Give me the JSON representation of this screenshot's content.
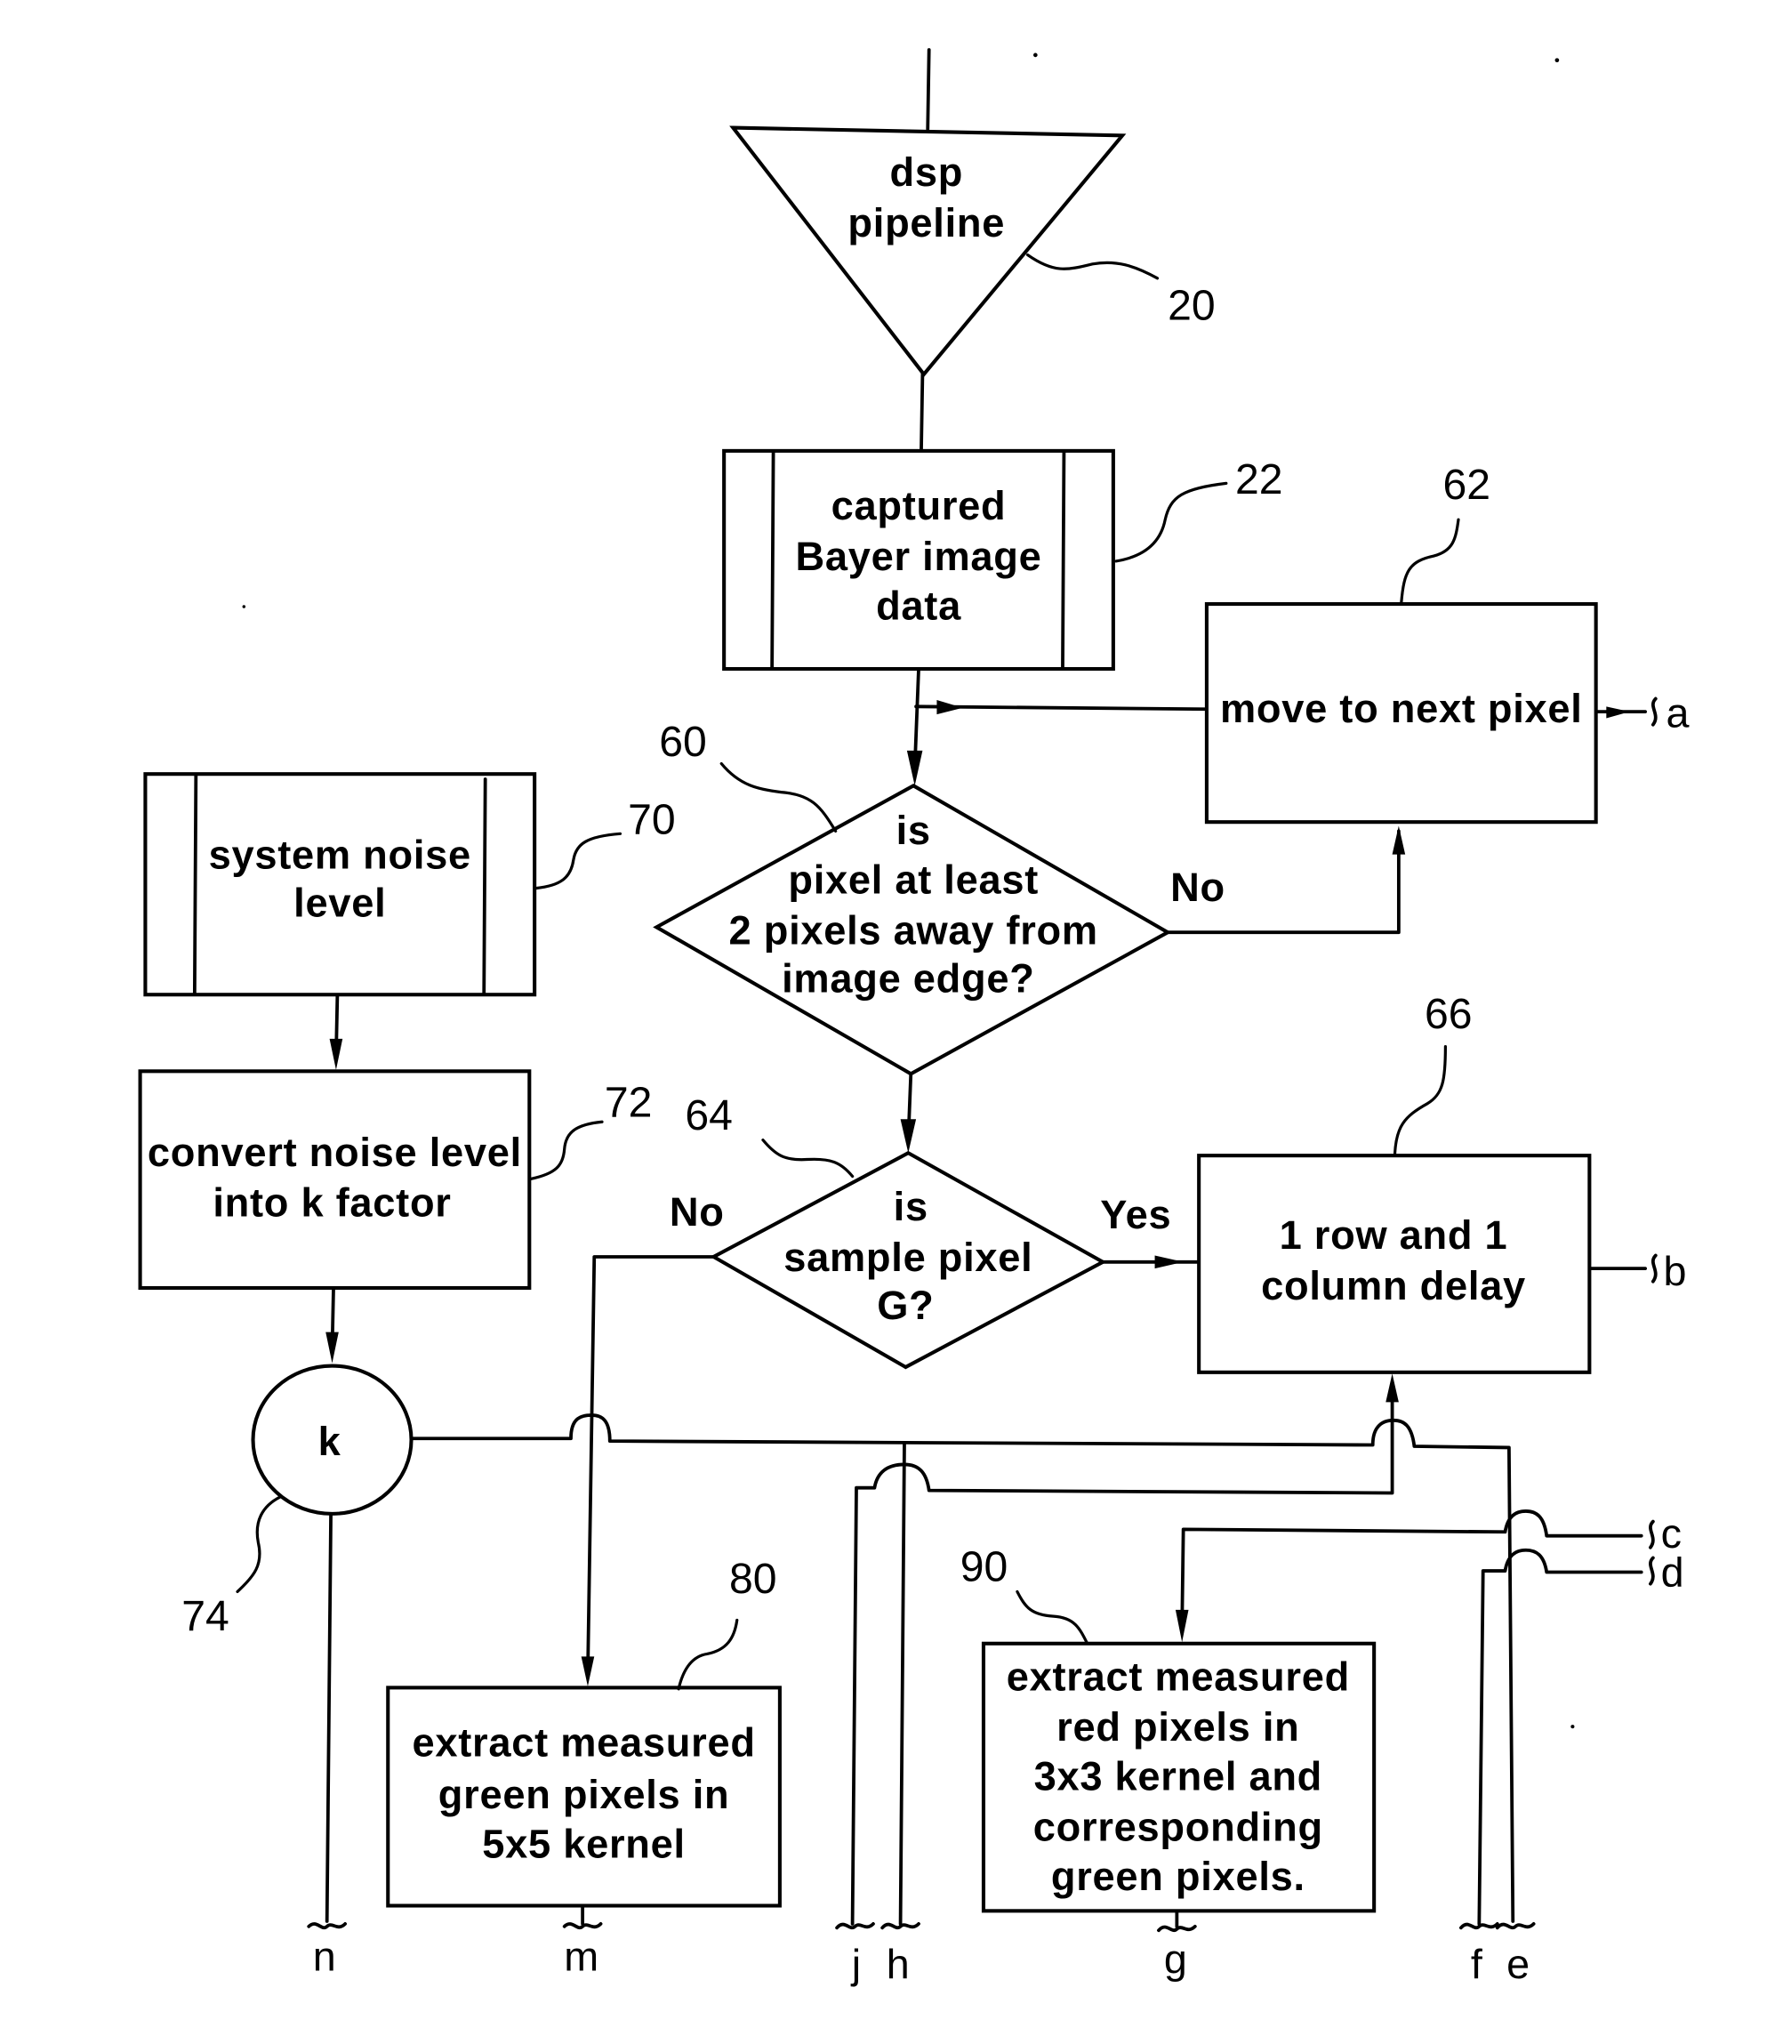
{
  "figure": {
    "type": "flowchart",
    "nodes": {
      "dsp_pipeline": {
        "ref": "20",
        "shape": "triangle",
        "lines": [
          "dsp",
          "pipeline"
        ]
      },
      "bayer_data": {
        "ref": "22",
        "shape": "predefined-process",
        "lines": [
          "captured",
          "Bayer image",
          "data"
        ]
      },
      "edge_check": {
        "ref": "60",
        "shape": "decision",
        "lines": [
          "is",
          "pixel at least",
          "2 pixels away from",
          "image edge?"
        ]
      },
      "next_pixel": {
        "ref": "62",
        "shape": "process",
        "lines": [
          "move to next pixel"
        ]
      },
      "green_check": {
        "ref": "64",
        "shape": "decision",
        "lines": [
          "is",
          "sample pixel",
          "G?"
        ]
      },
      "delay": {
        "ref": "66",
        "shape": "process",
        "lines": [
          "1 row and 1",
          "column delay"
        ]
      },
      "noise_level": {
        "ref": "70",
        "shape": "predefined-process",
        "lines": [
          "system noise",
          "level"
        ]
      },
      "k_factor": {
        "ref": "72",
        "shape": "process",
        "lines": [
          "convert noise level",
          "into k factor"
        ]
      },
      "k": {
        "ref": "74",
        "shape": "circle",
        "lines": [
          "k"
        ]
      },
      "green_extract": {
        "ref": "80",
        "shape": "process",
        "lines": [
          "extract measured",
          "green pixels in",
          "5x5 kernel"
        ]
      },
      "red_extract": {
        "ref": "90",
        "shape": "process",
        "lines": [
          "extract measured",
          "red pixels in",
          "3x3 kernel and",
          "corresponding",
          "green pixels."
        ]
      }
    },
    "edge_labels": {
      "edge_no": "No",
      "green_no": "No",
      "green_yes": "Yes"
    },
    "connectors": {
      "a": "a",
      "b": "b",
      "c": "c",
      "d": "d",
      "e": "e",
      "f": "f",
      "g": "g",
      "h": "h",
      "j": "j",
      "m": "m",
      "n": "n"
    },
    "edges": [
      [
        "input",
        "dsp_pipeline"
      ],
      [
        "dsp_pipeline",
        "bayer_data"
      ],
      [
        "bayer_data",
        "edge_check"
      ],
      [
        "next_pixel",
        "edge_check"
      ],
      [
        "edge_check",
        "next_pixel",
        "No"
      ],
      [
        "edge_check",
        "green_check"
      ],
      [
        "green_check",
        "delay",
        "Yes"
      ],
      [
        "green_check",
        "green_extract",
        "No"
      ],
      [
        "noise_level",
        "k_factor"
      ],
      [
        "k_factor",
        "k"
      ],
      [
        "j",
        "delay"
      ],
      [
        "c",
        "red_extract"
      ]
    ]
  }
}
